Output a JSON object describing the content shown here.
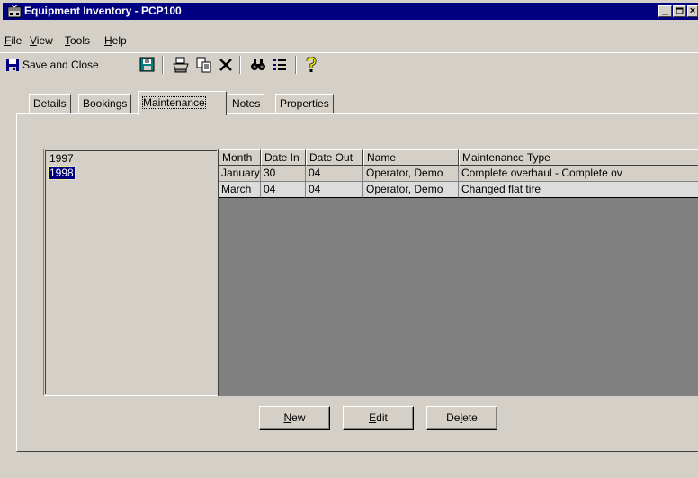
{
  "window": {
    "title": "Equipment Inventory - PCP100",
    "title_bar_color": "#000080",
    "controls": [
      "minimize-icon",
      "maximize-icon",
      "close-icon"
    ]
  },
  "menu": {
    "items": [
      {
        "label": "File",
        "accel": "F",
        "rest": "ile"
      },
      {
        "label": "View",
        "accel": "V",
        "rest": "iew"
      },
      {
        "label": "Tools",
        "accel": "T",
        "rest": "ools"
      },
      {
        "label": "Help",
        "accel": "H",
        "rest": "elp"
      }
    ]
  },
  "toolbar": {
    "save_close_label": "Save and Close",
    "icons": [
      "save-icon",
      "save-new-icon",
      "print-icon",
      "copy-icon",
      "delete-icon",
      "find-icon",
      "list-icon",
      "help-icon"
    ]
  },
  "tabs": {
    "items": [
      "Details",
      "Bookings",
      "Maintenance",
      "Notes",
      "Properties"
    ],
    "active": "Maintenance"
  },
  "years": {
    "items": [
      "1997",
      "1998"
    ],
    "selected": "1998",
    "selection_color": "#000080"
  },
  "grid": {
    "columns": [
      "Month",
      "Date In",
      "Date Out",
      "Name",
      "Maintenance Type"
    ],
    "rows": [
      [
        "January",
        "30",
        "04",
        "Operator, Demo",
        "Complete overhaul - Complete ov"
      ],
      [
        "March",
        "04",
        "04",
        "Operator, Demo",
        "Changed flat tire"
      ]
    ],
    "empty_area_color": "#808080"
  },
  "buttons": {
    "new": {
      "label": "New",
      "accel": "N",
      "rest": "ew"
    },
    "edit": {
      "label": "Edit",
      "accel": "E",
      "rest": "dit"
    },
    "delete": {
      "label": "Delete",
      "pre": "De",
      "accel": "l",
      "rest": "ete"
    }
  }
}
